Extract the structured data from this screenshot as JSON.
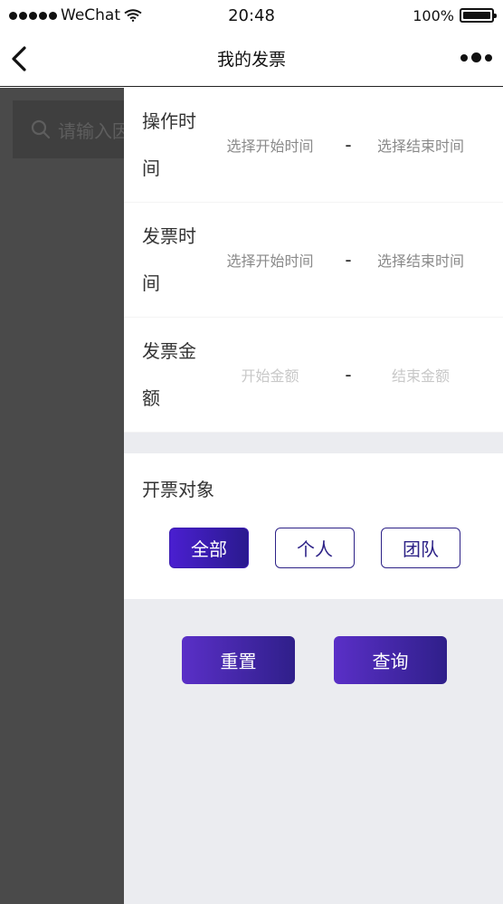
{
  "status_bar": {
    "carrier": "WeChat",
    "time": "20:48",
    "battery_level": "100%",
    "battery_fill_fraction": 1.0
  },
  "nav": {
    "title": "我的发票",
    "back_icon": "chevron-left-icon",
    "more_icon": "more-dots-icon"
  },
  "background_page": {
    "search_placeholder": "请输入因"
  },
  "filter": {
    "operation_time": {
      "label_line1": "操作时",
      "label_line2": "间",
      "start_placeholder": "选择开始时间",
      "separator": "-",
      "end_placeholder": "选择结束时间"
    },
    "invoice_time": {
      "label_line1": "发票时",
      "label_line2": "间",
      "start_placeholder": "选择开始时间",
      "separator": "-",
      "end_placeholder": "选择结束时间"
    },
    "invoice_amount": {
      "label_line1": "发票金",
      "label_line2": "额",
      "start_placeholder": "开始金额",
      "separator": "-",
      "end_placeholder": "结束金额"
    },
    "target": {
      "title": "开票对象",
      "options": [
        {
          "label": "全部",
          "selected": true
        },
        {
          "label": "个人",
          "selected": false
        },
        {
          "label": "团队",
          "selected": false
        }
      ]
    },
    "actions": {
      "reset_label": "重置",
      "query_label": "查询"
    }
  },
  "colors": {
    "accent": "#3a1cb0",
    "accent_dark": "#2d2287",
    "overlay": "#4a4a4a",
    "drawer_bg": "#ebecf0"
  }
}
